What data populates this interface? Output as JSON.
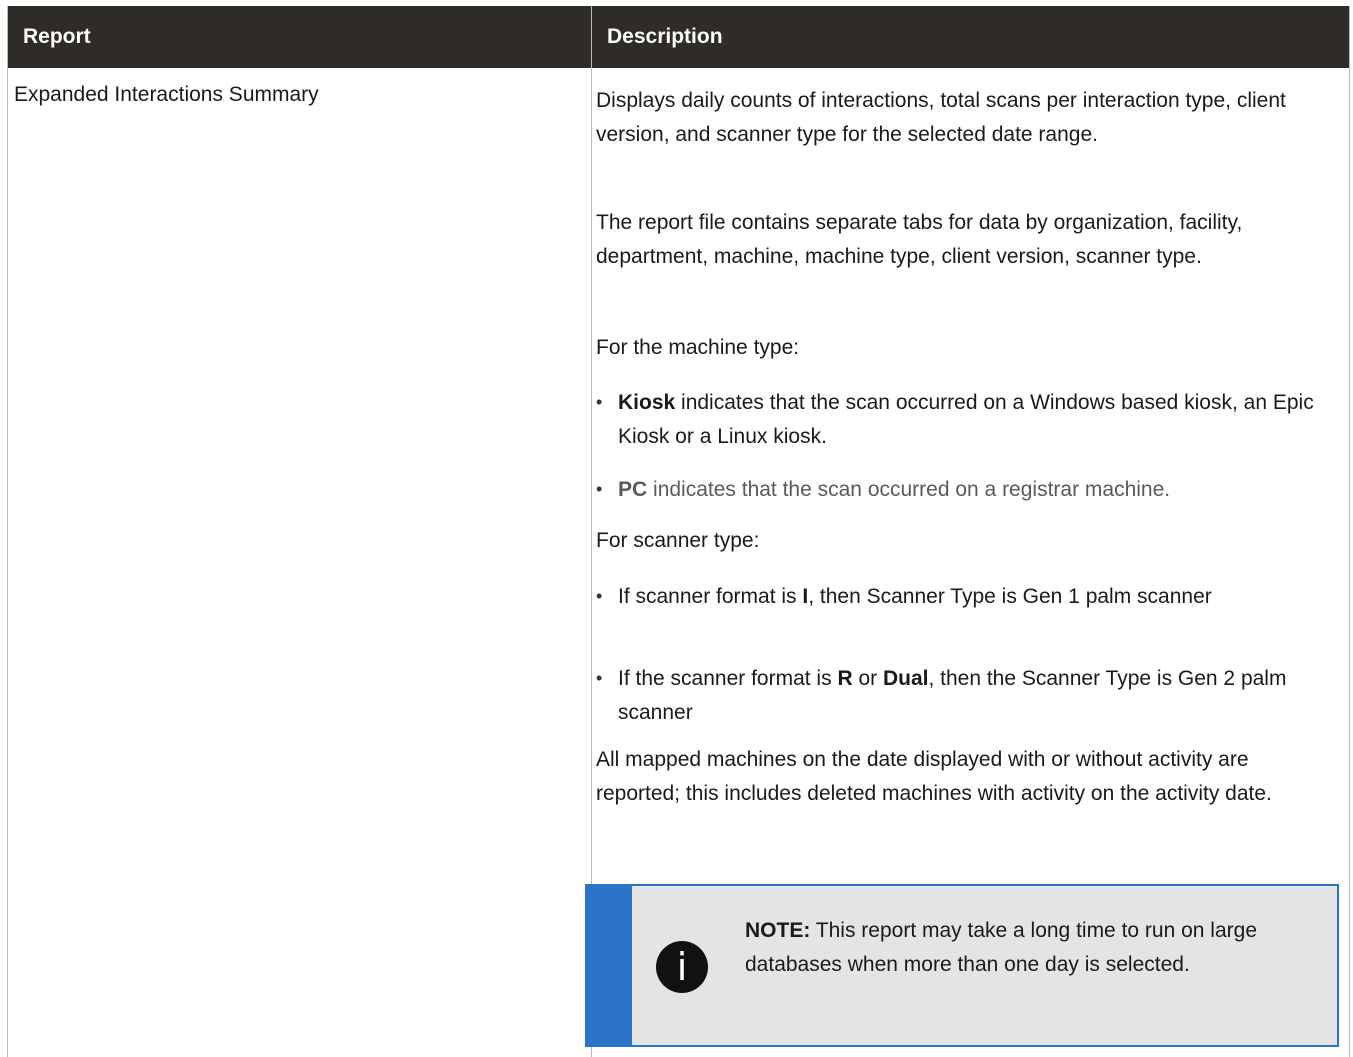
{
  "table": {
    "headers": [
      "Report",
      "Description"
    ],
    "rows": [
      {
        "report": "Expanded Interactions Summary",
        "description": {
          "para1": "Displays daily counts of interactions, total scans per interaction type, client version, and scanner type for the selected date range.",
          "para2": "The report file contains separate tabs for data by organization, facility, department, machine, machine type, client version, scanner type.",
          "machine_type_intro": "For the machine type:",
          "machine_type_bullets": [
            {
              "bold": "Kiosk",
              "text": " indicates that the scan occurred on a Windows based kiosk, an Epic Kiosk or a Linux kiosk."
            },
            {
              "bold": "PC",
              "text": " indicates that the scan occurred on a registrar machine."
            }
          ],
          "scanner_type_intro": "For scanner type:",
          "scanner_bullet1": {
            "pre": "If scanner format is ",
            "bold": "I",
            "post": ", then Scanner Type is Gen 1 palm scanner"
          },
          "scanner_bullet2": {
            "pre": "If the scanner format is ",
            "bold1": "R",
            "mid": " or ",
            "bold2": "Dual",
            "post": ", then the Scanner Type is Gen 2 palm scanner"
          },
          "para_last": "All mapped machines on the date displayed with or without activity are reported; this includes deleted machines with activity on the activity date.",
          "note": {
            "icon": "info-icon",
            "label": "NOTE:",
            "text": " This report may take a long time to run on large databases when more than one day is selected."
          }
        }
      }
    ]
  },
  "colors": {
    "header_bg": "#2f2c28",
    "note_accent": "#2b74c9",
    "note_bg": "#e4e4e4"
  }
}
